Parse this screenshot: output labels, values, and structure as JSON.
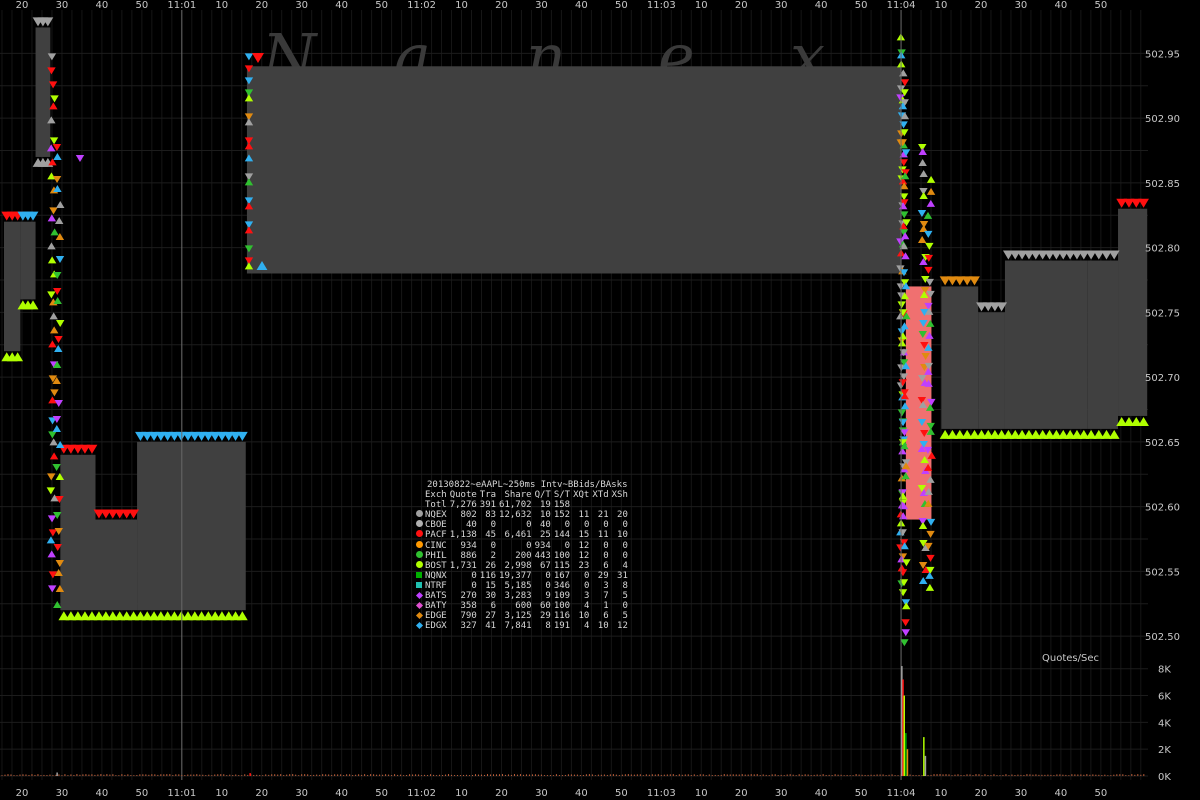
{
  "x_labels": [
    {
      "t": 20,
      "text": "20"
    },
    {
      "t": 30,
      "text": "30"
    },
    {
      "t": 40,
      "text": "40"
    },
    {
      "t": 50,
      "text": "50"
    },
    {
      "t": 60,
      "text": "11:01"
    },
    {
      "t": 70,
      "text": "10"
    },
    {
      "t": 80,
      "text": "20"
    },
    {
      "t": 90,
      "text": "30"
    },
    {
      "t": 100,
      "text": "40"
    },
    {
      "t": 110,
      "text": "50"
    },
    {
      "t": 120,
      "text": "11:02"
    },
    {
      "t": 130,
      "text": "10"
    },
    {
      "t": 140,
      "text": "20"
    },
    {
      "t": 150,
      "text": "30"
    },
    {
      "t": 160,
      "text": "40"
    },
    {
      "t": 170,
      "text": "50"
    },
    {
      "t": 180,
      "text": "11:03"
    },
    {
      "t": 190,
      "text": "10"
    },
    {
      "t": 200,
      "text": "20"
    },
    {
      "t": 210,
      "text": "30"
    },
    {
      "t": 220,
      "text": "40"
    },
    {
      "t": 230,
      "text": "50"
    },
    {
      "t": 240,
      "text": "11:04"
    },
    {
      "t": 250,
      "text": "10"
    },
    {
      "t": 260,
      "text": "20"
    },
    {
      "t": 270,
      "text": "30"
    },
    {
      "t": 280,
      "text": "40"
    },
    {
      "t": 290,
      "text": "50"
    }
  ],
  "y_labels": [
    "502.50",
    "502.55",
    "502.60",
    "502.65",
    "502.70",
    "502.75",
    "502.80",
    "502.85",
    "502.90",
    "502.95"
  ],
  "watermark": [
    "N",
    "a",
    "n",
    "e",
    "x"
  ],
  "colors": {
    "background": "#000000",
    "band": "#404040",
    "crossed": "#f07070",
    "grid": "#1e1e1e",
    "NQEX": "#a0a0a0",
    "CBOE": "#b0b0b0",
    "PACF": "#ff1010",
    "CINC": "#ff9900",
    "PHIL": "#30c030",
    "BOST": "#b0ff00",
    "NQNX": "#00b000",
    "NTRF": "#20c0b0",
    "BATS": "#c040ff",
    "BATY": "#e050d0",
    "EDGE": "#e08a10",
    "EDGX": "#30b0f0"
  },
  "chart_data": {
    "type": "area",
    "title": "20130822~eAAPL~250ms Intv~BBids/BAsks",
    "x_unit": "seconds after 11:00:00",
    "ylim": [
      502.48,
      502.985
    ],
    "xlim": [
      14.5,
      302.3
    ],
    "bbo": [
      {
        "t0": 15.5,
        "t1": 19.6,
        "bid": 502.72,
        "ask": 502.82
      },
      {
        "t0": 19.6,
        "t1": 23.4,
        "bid": 502.76,
        "ask": 502.82
      },
      {
        "t0": 23.4,
        "t1": 27.1,
        "bid": 502.87,
        "ask": 502.97
      },
      {
        "t0": 29.6,
        "t1": 38.4,
        "bid": 502.52,
        "ask": 502.64
      },
      {
        "t0": 38.4,
        "t1": 48.8,
        "bid": 502.52,
        "ask": 502.59
      },
      {
        "t0": 48.8,
        "t1": 76.0,
        "bid": 502.52,
        "ask": 502.65
      },
      {
        "t0": 76.3,
        "t1": 240.1,
        "bid": 502.78,
        "ask": 502.94
      },
      {
        "t0": 250.1,
        "t1": 259.3,
        "bid": 502.66,
        "ask": 502.77
      },
      {
        "t0": 259.3,
        "t1": 266.0,
        "bid": 502.66,
        "ask": 502.75
      },
      {
        "t0": 266.0,
        "t1": 286.6,
        "bid": 502.66,
        "ask": 502.79
      },
      {
        "t0": 286.6,
        "t1": 294.3,
        "bid": 502.66,
        "ask": 502.79
      },
      {
        "t0": 294.3,
        "t1": 301.6,
        "bid": 502.67,
        "ask": 502.83
      }
    ],
    "crossed": [
      {
        "t0": 241.2,
        "t1": 247.6,
        "bid": 502.59,
        "ask": 502.77
      }
    ],
    "volume_panel": {
      "title": "Quotes/Sec",
      "y_ticks": [
        "0K",
        "2K",
        "4K",
        "6K",
        "8K"
      ],
      "ylim": [
        0,
        8500
      ],
      "spikes": [
        {
          "t": 240.2,
          "v": 8200,
          "c": "NQEX"
        },
        {
          "t": 240.5,
          "v": 7200,
          "c": "PACF"
        },
        {
          "t": 240.8,
          "v": 6000,
          "c": "BOST"
        },
        {
          "t": 241.2,
          "v": 3200,
          "c": "NQNX"
        },
        {
          "t": 241.6,
          "v": 2000,
          "c": "EDGE"
        },
        {
          "t": 245.7,
          "v": 2900,
          "c": "BOST"
        },
        {
          "t": 246.1,
          "v": 1500,
          "c": "NQEX"
        },
        {
          "t": 28.8,
          "v": 260,
          "c": "NQEX"
        },
        {
          "t": 77.1,
          "v": 220,
          "c": "PACF"
        }
      ]
    },
    "stats_table": {
      "header": [
        "Exch",
        "Quote",
        "Tra",
        "Share",
        "Q/T",
        "S/T",
        "XQt",
        "XTd",
        "XSh"
      ],
      "rows": [
        {
          "ex": "Totl",
          "v": [
            "7,276",
            "391",
            "61,702",
            "19",
            "158",
            "",
            "",
            ""
          ]
        },
        {
          "ex": "NQEX",
          "v": [
            "802",
            "83",
            "12,632",
            "10",
            "152",
            "11",
            "21",
            "20"
          ]
        },
        {
          "ex": "CBOE",
          "v": [
            "40",
            "0",
            "0",
            "40",
            "0",
            "0",
            "0",
            "0"
          ]
        },
        {
          "ex": "PACF",
          "v": [
            "1,138",
            "45",
            "6,461",
            "25",
            "144",
            "15",
            "11",
            "10"
          ]
        },
        {
          "ex": "CINC",
          "v": [
            "934",
            "0",
            "0",
            "934",
            "0",
            "12",
            "0",
            "0"
          ]
        },
        {
          "ex": "PHIL",
          "v": [
            "886",
            "2",
            "200",
            "443",
            "100",
            "12",
            "0",
            "0"
          ]
        },
        {
          "ex": "BOST",
          "v": [
            "1,731",
            "26",
            "2,998",
            "67",
            "115",
            "23",
            "6",
            "4"
          ]
        },
        {
          "ex": "NQNX",
          "v": [
            "0",
            "116",
            "19,377",
            "0",
            "167",
            "0",
            "29",
            "31"
          ]
        },
        {
          "ex": "NTRF",
          "v": [
            "0",
            "15",
            "5,185",
            "0",
            "346",
            "0",
            "3",
            "8"
          ]
        },
        {
          "ex": "BATS",
          "v": [
            "270",
            "30",
            "3,283",
            "9",
            "109",
            "3",
            "7",
            "5"
          ]
        },
        {
          "ex": "BATY",
          "v": [
            "358",
            "6",
            "600",
            "60",
            "100",
            "4",
            "1",
            "0"
          ]
        },
        {
          "ex": "EDGE",
          "v": [
            "790",
            "27",
            "3,125",
            "29",
            "116",
            "10",
            "6",
            "5"
          ]
        },
        {
          "ex": "EDGX",
          "v": [
            "327",
            "41",
            "7,841",
            "8",
            "191",
            "4",
            "10",
            "12"
          ]
        }
      ]
    }
  }
}
